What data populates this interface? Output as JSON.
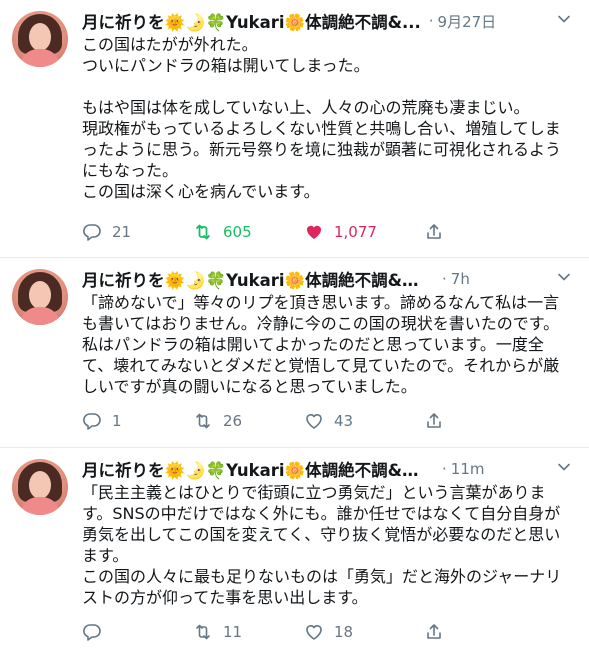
{
  "tweets": [
    {
      "author": "月に祈りを🌞🌛🍀Yukari🌼体調絶不調&...",
      "time": "9月27日",
      "text": "この国はたがが外れた。\nついにパンドラの箱は開いてしまった。\n\nもはや国は体を成していない上、人々の心の荒廃も凄まじい。\n現政権がもっているよろしくない性質と共鳴し合い、増殖してしまったように思う。新元号祭りを境に独裁が顕著に可視化されるようにもなった。\nこの国は深く心を病んでいます。",
      "replies": "21",
      "retweets": "605",
      "likes": "1,077",
      "retweeted": true,
      "liked": true
    },
    {
      "author": "月に祈りを🌞🌛🍀Yukari🌼体調絶不調&多忙で...",
      "time": "7h",
      "text": "「諦めないで」等々のリプを頂き思います。諦めるなんて私は一言も書いてはおりません。冷静に今のこの国の現状を書いたのです。私はパンドラの箱は開いてよかったのだと思っています。一度全て、壊れてみないとダメだと覚悟して見ていたので。それからが厳しいですが真の闘いになると思っていました。",
      "replies": "1",
      "retweets": "26",
      "likes": "43",
      "retweeted": false,
      "liked": false
    },
    {
      "author": "月に祈りを🌞🌛🍀Yukari🌼体調絶不調&多忙...",
      "time": "11m",
      "text": "「民主主義とはひとりで街頭に立つ勇気だ」という言葉があります。SNSの中だけではなく外にも。誰か任せではなくて自分自身が勇気を出してこの国を変えてく、守り抜く覚悟が必要なのだと思います。\nこの国の人々に最も足りないものは「勇気」だと海外のジャーナリストの方が仰ってた事を思い出します。",
      "replies": "",
      "retweets": "11",
      "likes": "18",
      "retweeted": false,
      "liked": false
    }
  ],
  "icons": {
    "reply": "reply-icon",
    "retweet": "retweet-icon",
    "like": "heart-icon",
    "share": "share-icon",
    "menu": "chevron-down-icon"
  },
  "colors": {
    "text": "#14171a",
    "muted": "#657786",
    "retweet_active": "#17bf63",
    "like_active": "#e0245e",
    "divider": "#e6ecf0"
  }
}
